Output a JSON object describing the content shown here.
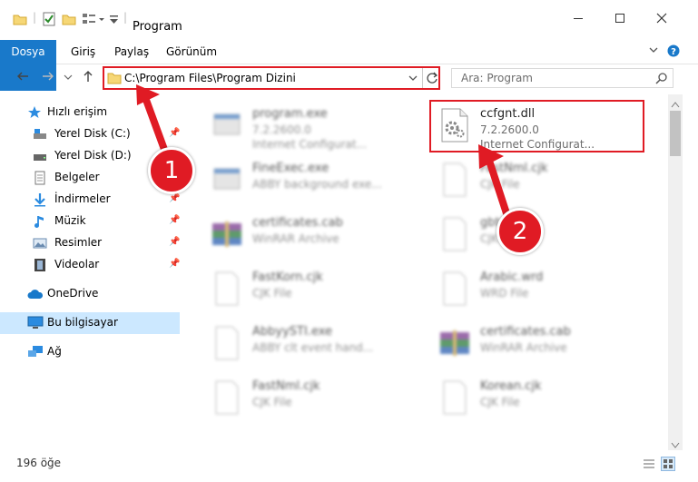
{
  "window": {
    "title": "Program"
  },
  "ribbon": {
    "tabs": [
      "Dosya",
      "Giriş",
      "Paylaş",
      "Görünüm"
    ]
  },
  "address": {
    "path": "C:\\Program Files\\Program Dizini"
  },
  "search": {
    "placeholder": "Ara: Program"
  },
  "sidebar": {
    "items": [
      {
        "label": "Hızlı erişim"
      },
      {
        "label": "Yerel Disk (C:)"
      },
      {
        "label": "Yerel Disk (D:)"
      },
      {
        "label": "Belgeler"
      },
      {
        "label": "İndirmeler"
      },
      {
        "label": "Müzik"
      },
      {
        "label": "Resimler"
      },
      {
        "label": "Videolar"
      },
      {
        "label": "OneDrive"
      },
      {
        "label": "Bu bilgisayar"
      },
      {
        "label": "Ağ"
      }
    ]
  },
  "files": [
    {
      "name": "program.exe",
      "l2": "7.2.2600.0",
      "l3": "Internet Configurat..."
    },
    {
      "name": "ccfgnt.dll",
      "l2": "7.2.2600.0",
      "l3": "Internet Configurat..."
    },
    {
      "name": "FineExec.exe",
      "l2": "ABBY background exe...",
      "l3": ""
    },
    {
      "name": "FastNml.cjk",
      "l2": "CJK File",
      "l3": ""
    },
    {
      "name": "certificates.cab",
      "l2": "WinRAR Archive",
      "l3": ""
    },
    {
      "name": "gbt.cjk",
      "l2": "CJK File",
      "l3": ""
    },
    {
      "name": "FastKorn.cjk",
      "l2": "CJK File",
      "l3": ""
    },
    {
      "name": "Arabic.wrd",
      "l2": "WRD File",
      "l3": ""
    },
    {
      "name": "AbbyySTI.exe",
      "l2": "ABBY clt event hand...",
      "l3": ""
    },
    {
      "name": "certificates.cab",
      "l2": "WinRAR Archive",
      "l3": ""
    },
    {
      "name": "FastNml.cjk",
      "l2": "CJK File",
      "l3": ""
    },
    {
      "name": "Korean.cjk",
      "l2": "CJK File",
      "l3": ""
    }
  ],
  "status": {
    "count": "196 öğe"
  },
  "badges": {
    "one": "1",
    "two": "2"
  },
  "colors": {
    "accent": "#1979ca",
    "highlight": "#e01b24"
  }
}
